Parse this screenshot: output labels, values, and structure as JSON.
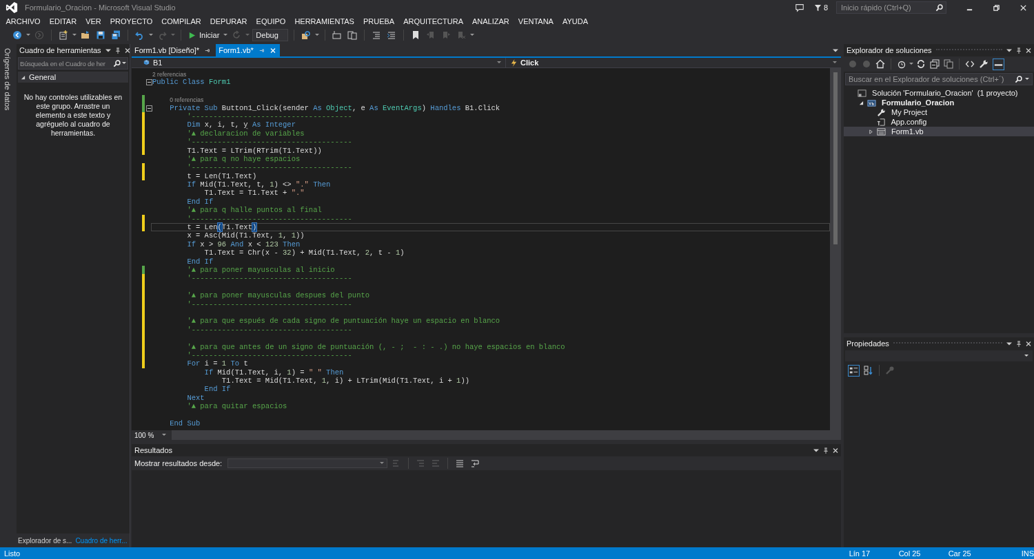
{
  "window": {
    "title": "Formulario_Oracion - Microsoft Visual Studio",
    "notification_count": "8",
    "quick_launch": {
      "placeholder": "Inicio rápido (Ctrl+Q)"
    }
  },
  "menu": [
    "ARCHIVO",
    "EDITAR",
    "VER",
    "PROYECTO",
    "COMPILAR",
    "DEPURAR",
    "EQUIPO",
    "HERRAMIENTAS",
    "PRUEBA",
    "ARQUITECTURA",
    "ANALIZAR",
    "VENTANA",
    "AYUDA"
  ],
  "toolbar": {
    "start_label": "Iniciar",
    "configuration": "Debug"
  },
  "side_tabs": [
    "Orígenes de datos"
  ],
  "toolbox": {
    "title": "Cuadro de herramientas",
    "search": {
      "placeholder": "Búsqueda en el Cuadro de her"
    },
    "group": {
      "label": "General",
      "expanded": true
    },
    "message": "No hay controles utilizables en este grupo. Arrastre un elemento a este texto y agréguelo al cuadro de herramientas."
  },
  "bottom_tabs": [
    {
      "label": "Explorador de s...",
      "selected": false
    },
    {
      "label": "Cuadro de herr...",
      "selected": true
    }
  ],
  "document_tabs": [
    {
      "label": "Form1.vb [Diseño]*",
      "selected": false
    },
    {
      "label": "Form1.vb*",
      "selected": true
    }
  ],
  "navigation": {
    "object": "B1",
    "event": "Click"
  },
  "editor": {
    "lines": [
      {
        "kind": "code",
        "lens": "2 referencias",
        "expanded": true,
        "tokens": [
          {
            "kind": "kw",
            "text": "Public Class "
          },
          {
            "kind": "type",
            "text": "Form1"
          }
        ]
      },
      {
        "kind": "blank"
      },
      {
        "kind": "code",
        "lens": "0 referencias",
        "expanded": true,
        "color": "#57a64a",
        "tokens": [
          {
            "kind": "kw",
            "text": "    Private Sub "
          },
          {
            "kind": "txt",
            "text": "Button1_Click(sender "
          },
          {
            "kind": "kw",
            "text": "As "
          },
          {
            "kind": "type",
            "text": "Object"
          },
          {
            "kind": "txt",
            "text": ", e "
          },
          {
            "kind": "kw",
            "text": "As "
          },
          {
            "kind": "type",
            "text": "EventArgs"
          },
          {
            "kind": "txt",
            "text": ") "
          },
          {
            "kind": "kw",
            "text": "Handles "
          },
          {
            "kind": "txt",
            "text": "B1.Click"
          }
        ]
      },
      {
        "kind": "code",
        "color": "#efce1c",
        "tokens": [
          {
            "kind": "com",
            "text": "        '-------------------------------------"
          }
        ]
      },
      {
        "kind": "code",
        "color": "#efce1c",
        "tokens": [
          {
            "kind": "kw",
            "text": "        Dim "
          },
          {
            "kind": "txt",
            "text": "x, i, t, "
          },
          {
            "kind": "warn",
            "text": "y"
          },
          {
            "kind": "kw",
            "text": " As Integer"
          }
        ]
      },
      {
        "kind": "code",
        "color": "#efce1c",
        "tokens": [
          {
            "kind": "com",
            "text": "        '▲ declaracion de variables"
          }
        ]
      },
      {
        "kind": "code",
        "color": "#efce1c",
        "tokens": [
          {
            "kind": "com",
            "text": "        '-------------------------------------"
          }
        ]
      },
      {
        "kind": "code",
        "color": "#efce1c",
        "tokens": [
          {
            "kind": "txt",
            "text": "        T1.Text = LTrim(RTrim(T1.Text))"
          }
        ]
      },
      {
        "kind": "code",
        "tokens": [
          {
            "kind": "com",
            "text": "        '▲ para q no haye espacios"
          }
        ]
      },
      {
        "kind": "code",
        "color": "#efce1c",
        "tokens": [
          {
            "kind": "com",
            "text": "        '-------------------------------------"
          }
        ]
      },
      {
        "kind": "code",
        "color": "#efce1c",
        "tokens": [
          {
            "kind": "txt",
            "text": "        t = Len(T1.Text)"
          }
        ]
      },
      {
        "kind": "code",
        "tokens": [
          {
            "kind": "kw",
            "text": "        If "
          },
          {
            "kind": "txt",
            "text": "Mid(T1.Text, t, "
          },
          {
            "kind": "num",
            "text": "1"
          },
          {
            "kind": "txt",
            "text": ") <> "
          },
          {
            "kind": "str",
            "text": "\".\""
          },
          {
            "kind": "kw",
            "text": " Then"
          }
        ]
      },
      {
        "kind": "code",
        "tokens": [
          {
            "kind": "txt",
            "text": "            T1.Text = T1.Text + "
          },
          {
            "kind": "str",
            "text": "\".\""
          }
        ]
      },
      {
        "kind": "code",
        "tokens": [
          {
            "kind": "kw",
            "text": "        End If"
          }
        ]
      },
      {
        "kind": "code",
        "tokens": [
          {
            "kind": "com",
            "text": "        '▲ para q halle puntos al final"
          }
        ]
      },
      {
        "kind": "code",
        "color": "#efce1c",
        "tokens": [
          {
            "kind": "com",
            "text": "        '-------------------------------------"
          }
        ]
      },
      {
        "kind": "code",
        "color": "#efce1c",
        "current": true,
        "tokens": [
          {
            "kind": "txt",
            "text": "        t = Len"
          },
          {
            "kind": "match",
            "text": "("
          },
          {
            "kind": "txt",
            "text": "T1.Text"
          },
          {
            "kind": "match",
            "text": ")"
          }
        ]
      },
      {
        "kind": "code",
        "tokens": [
          {
            "kind": "txt",
            "text": "        x = Asc(Mid(T1.Text, "
          },
          {
            "kind": "num",
            "text": "1"
          },
          {
            "kind": "txt",
            "text": ", "
          },
          {
            "kind": "num",
            "text": "1"
          },
          {
            "kind": "txt",
            "text": "))"
          }
        ]
      },
      {
        "kind": "code",
        "tokens": [
          {
            "kind": "kw",
            "text": "        If "
          },
          {
            "kind": "txt",
            "text": "x > "
          },
          {
            "kind": "num",
            "text": "96"
          },
          {
            "kind": "kw",
            "text": " And "
          },
          {
            "kind": "txt",
            "text": "x < "
          },
          {
            "kind": "num",
            "text": "123"
          },
          {
            "kind": "kw",
            "text": " Then"
          }
        ]
      },
      {
        "kind": "code",
        "tokens": [
          {
            "kind": "txt",
            "text": "            T1.Text = Chr(x - "
          },
          {
            "kind": "num",
            "text": "32"
          },
          {
            "kind": "txt",
            "text": ") + Mid(T1.Text, "
          },
          {
            "kind": "num",
            "text": "2"
          },
          {
            "kind": "txt",
            "text": ", t - "
          },
          {
            "kind": "num",
            "text": "1"
          },
          {
            "kind": "txt",
            "text": ")"
          }
        ]
      },
      {
        "kind": "code",
        "tokens": [
          {
            "kind": "kw",
            "text": "        End If"
          }
        ]
      },
      {
        "kind": "code",
        "color": "#57a64a",
        "tokens": [
          {
            "kind": "com",
            "text": "        '▲ para poner mayusculas al inicio"
          }
        ]
      },
      {
        "kind": "code",
        "color": "#efce1c",
        "tokens": [
          {
            "kind": "com",
            "text": "        '-------------------------------------"
          }
        ]
      },
      {
        "kind": "blank",
        "color": "#efce1c"
      },
      {
        "kind": "code",
        "color": "#efce1c",
        "tokens": [
          {
            "kind": "com",
            "text": "        '▲ para poner mayusculas despues del punto"
          }
        ]
      },
      {
        "kind": "code",
        "color": "#efce1c",
        "tokens": [
          {
            "kind": "com",
            "text": "        '-------------------------------------"
          }
        ]
      },
      {
        "kind": "blank",
        "color": "#efce1c"
      },
      {
        "kind": "code",
        "color": "#efce1c",
        "tokens": [
          {
            "kind": "com",
            "text": "        '▲ para que espués de cada signo de puntuación haye un espacio en blanco"
          }
        ]
      },
      {
        "kind": "code",
        "color": "#efce1c",
        "tokens": [
          {
            "kind": "com",
            "text": "        '-------------------------------------"
          }
        ]
      },
      {
        "kind": "blank",
        "color": "#efce1c"
      },
      {
        "kind": "code",
        "color": "#efce1c",
        "tokens": [
          {
            "kind": "com",
            "text": "        '▲ para que antes de un signo de puntuación (, - ;  - : - .) no haye espacios en blanco"
          }
        ]
      },
      {
        "kind": "code",
        "color": "#efce1c",
        "tokens": [
          {
            "kind": "com",
            "text": "        '-------------------------------------"
          }
        ]
      },
      {
        "kind": "code",
        "color": "#efce1c",
        "tokens": [
          {
            "kind": "kw",
            "text": "        For "
          },
          {
            "kind": "txt",
            "text": "i = "
          },
          {
            "kind": "num",
            "text": "1"
          },
          {
            "kind": "kw",
            "text": " To "
          },
          {
            "kind": "txt",
            "text": "t"
          }
        ]
      },
      {
        "kind": "code",
        "tokens": [
          {
            "kind": "kw",
            "text": "            If "
          },
          {
            "kind": "txt",
            "text": "Mid(T1.Text, i, "
          },
          {
            "kind": "num",
            "text": "1"
          },
          {
            "kind": "txt",
            "text": ") = "
          },
          {
            "kind": "str",
            "text": "\" \""
          },
          {
            "kind": "kw",
            "text": " Then"
          }
        ]
      },
      {
        "kind": "code",
        "tokens": [
          {
            "kind": "txt",
            "text": "                T1.Text = Mid(T1.Text, "
          },
          {
            "kind": "num",
            "text": "1"
          },
          {
            "kind": "txt",
            "text": ", i) + LTrim(Mid(T1.Text, i + "
          },
          {
            "kind": "num",
            "text": "1"
          },
          {
            "kind": "txt",
            "text": "))"
          }
        ]
      },
      {
        "kind": "code",
        "tokens": [
          {
            "kind": "kw",
            "text": "            End If"
          }
        ]
      },
      {
        "kind": "code",
        "tokens": [
          {
            "kind": "kw",
            "text": "        Next"
          }
        ]
      },
      {
        "kind": "code",
        "tokens": [
          {
            "kind": "com",
            "text": "        '▲ para quitar espacios"
          }
        ]
      },
      {
        "kind": "blank"
      },
      {
        "kind": "code",
        "tokens": [
          {
            "kind": "kw",
            "text": "    End Sub"
          }
        ]
      }
    ]
  },
  "zoom": "100 %",
  "output": {
    "title": "Resultados",
    "source_label": "Mostrar resultados desde:"
  },
  "solution_explorer": {
    "title": "Explorador de soluciones",
    "search": {
      "placeholder": "Buscar en el Explorador de soluciones (Ctrl+´)"
    },
    "tree": [
      {
        "label": "Solución 'Formulario_Oracion'  (1 proyecto)",
        "kind": "solution",
        "selected": false,
        "children": [
          {
            "label": "Formulario_Oracion",
            "kind": "project",
            "expanded": true,
            "selected": false,
            "children": [
              {
                "label": "My Project",
                "kind": "settings",
                "selected": false
              },
              {
                "label": "App.config",
                "kind": "config",
                "selected": false
              },
              {
                "label": "Form1.vb",
                "kind": "form",
                "expanded": false,
                "selected": true
              }
            ]
          }
        ]
      }
    ]
  },
  "properties": {
    "title": "Propiedades"
  },
  "status_bar": {
    "message": "Listo",
    "line": "Lín 17",
    "column": "Col 25",
    "character": "Car 25",
    "mode": "INS"
  }
}
